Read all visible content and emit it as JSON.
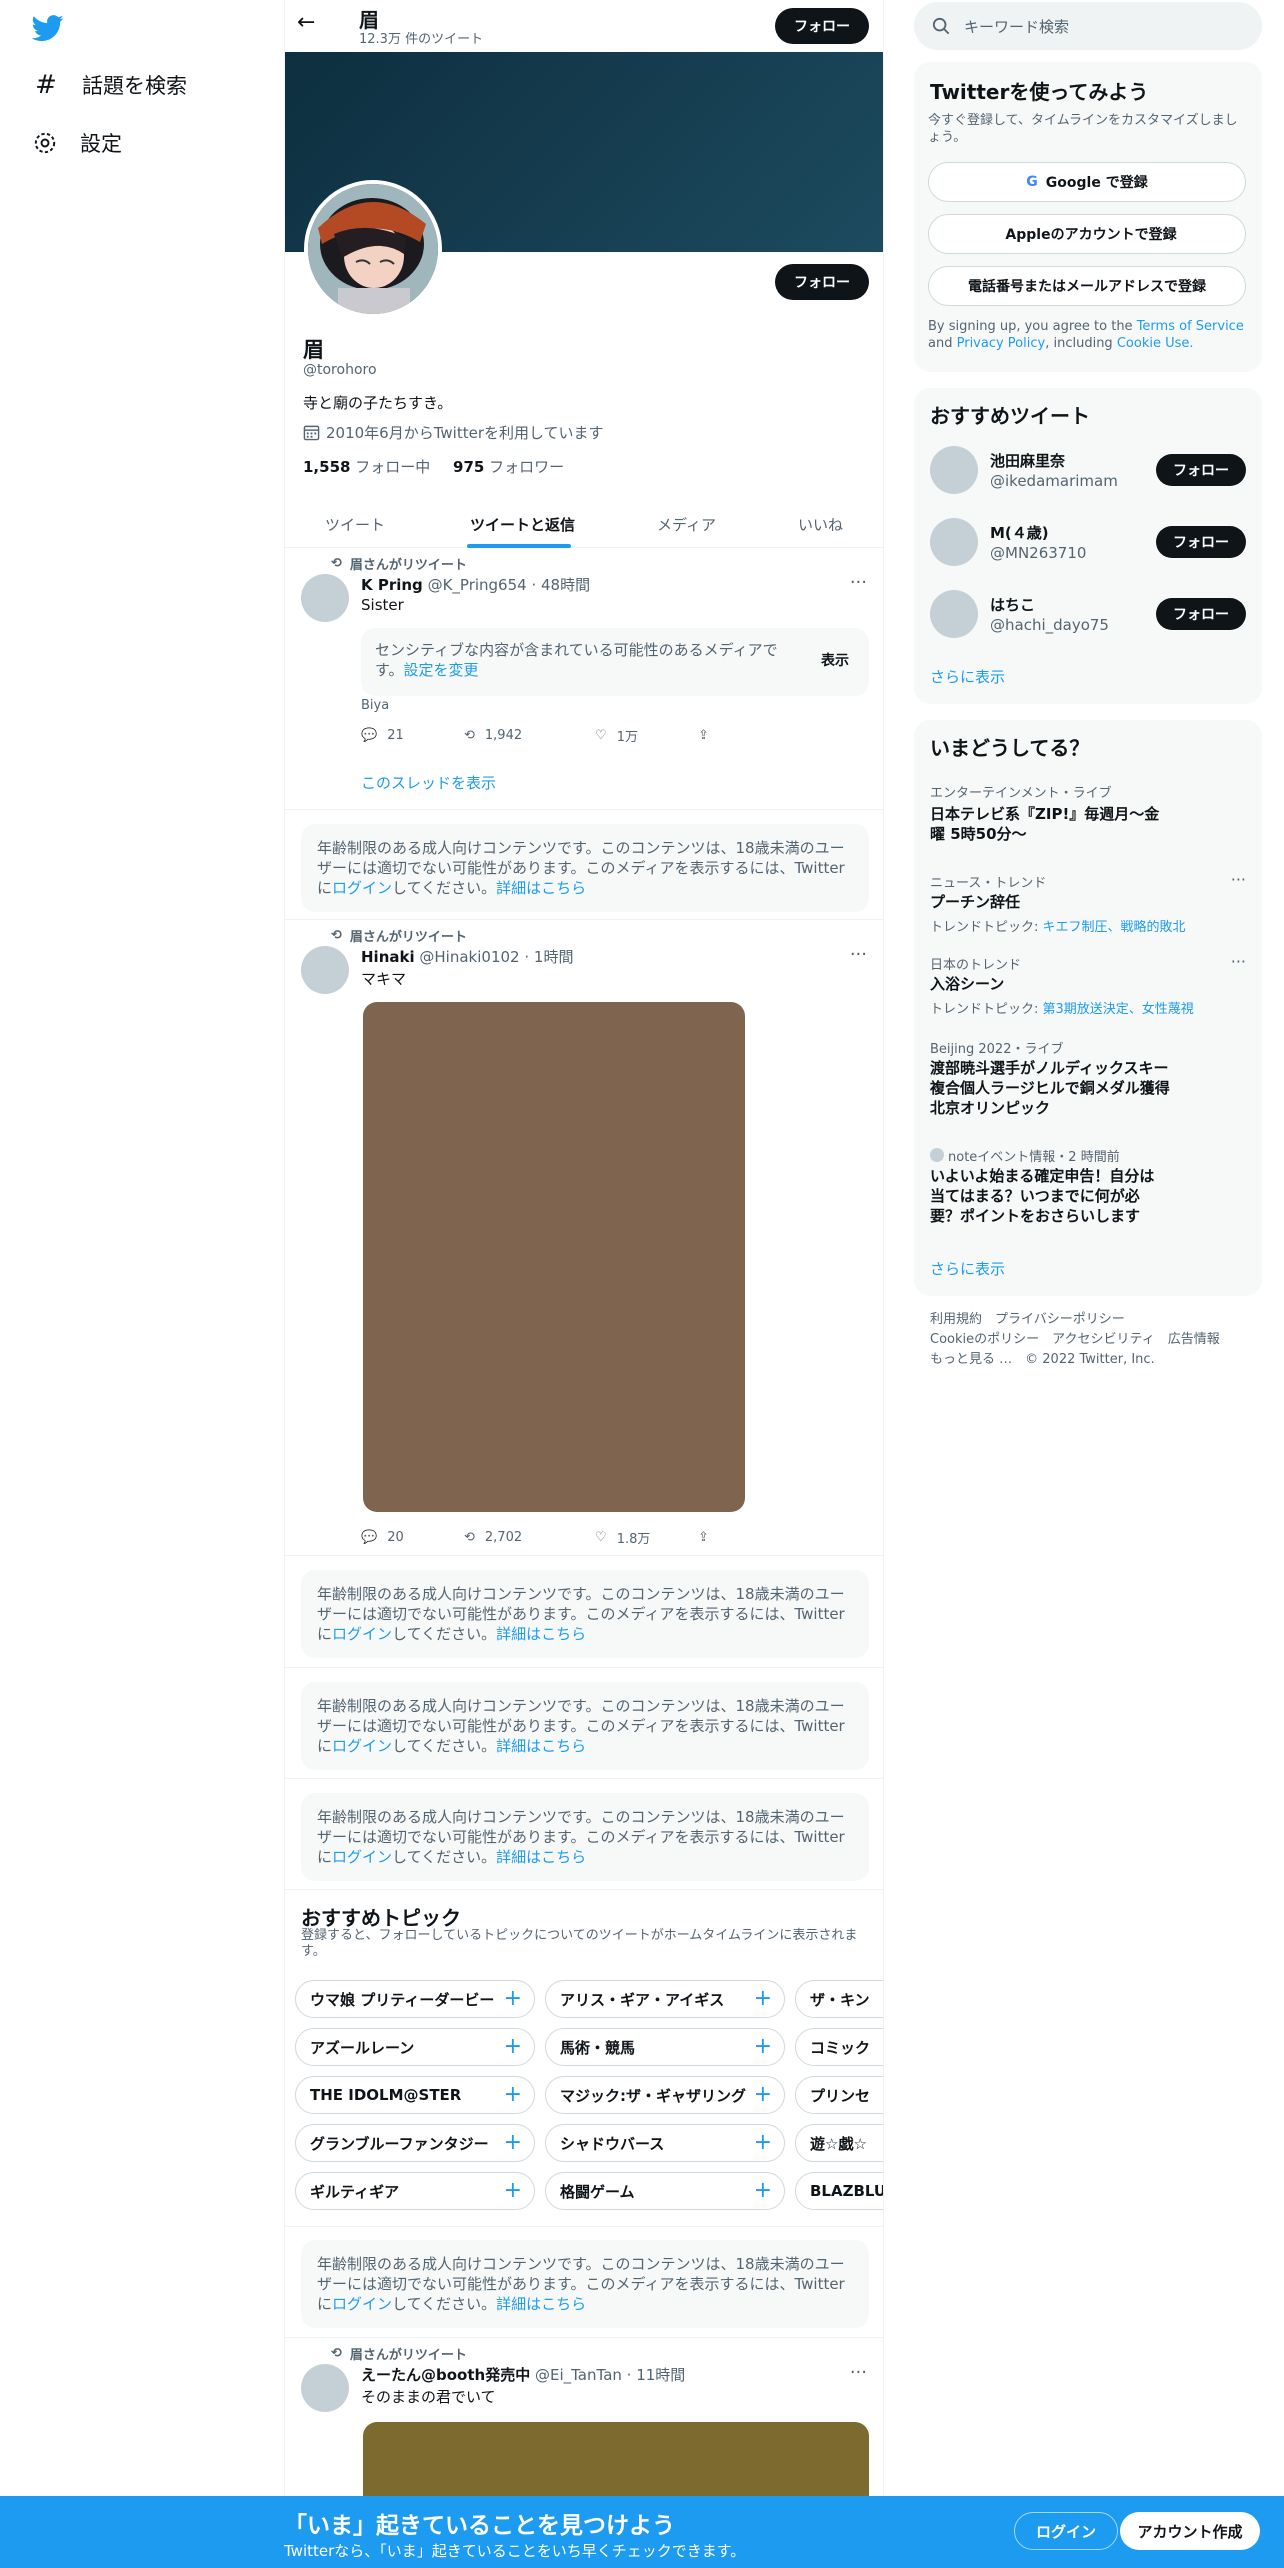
{
  "nav": {
    "items": [
      {
        "label": "話題を検索",
        "icon": "hashtag-icon"
      },
      {
        "label": "設定",
        "icon": "gear-icon"
      }
    ]
  },
  "header": {
    "name": "眉",
    "tweet_count": "12.3万 件のツイート",
    "follow_label": "フォロー"
  },
  "profile": {
    "name": "眉",
    "handle": "@torohoro",
    "bio": "寺と廟の子たちすき。",
    "joined": "2010年6月からTwitterを利用しています",
    "following_count": "1,558",
    "following_label": "フォロー中",
    "followers_count": "975",
    "followers_label": "フォロワー",
    "follow_label": "フォロー"
  },
  "tabs": [
    "ツイート",
    "ツイートと返信",
    "メディア",
    "いいね"
  ],
  "tweets": [
    {
      "retweet_label": "眉さんがリツイート",
      "name": "K Pring",
      "handle": "@K_Pring654",
      "time": "48時間",
      "text": "Sister",
      "sensitive": "センシティブな内容が含まれている可能性のあるメディアです。",
      "sensitive_link": "設定を変更",
      "sensitive_show": "表示",
      "caption": "Biya",
      "replies": "21",
      "retweets": "1,942",
      "likes": "1万",
      "thread_link": "このスレッドを表示"
    },
    {
      "retweet_label": "眉さんがリツイート",
      "name": "Hinaki",
      "handle": "@Hinaki0102",
      "time": "1時間",
      "text": "マキマ",
      "replies": "20",
      "retweets": "2,702",
      "likes": "1.8万"
    },
    {
      "retweet_label": "眉さんがリツイート",
      "name": "えーたん@booth発売中",
      "handle": "@Ei_TanTan",
      "time": "11時間",
      "text": "そのままの君でいて"
    }
  ],
  "notice": {
    "text": "年齢制限のある成人向けコンテンツです。このコンテンツは、18歳未満のユーザーには適切でない可能性があります。このメディアを表示するには、Twitterに",
    "login": "ログイン",
    "after": "してください。",
    "more": "詳細はこちら"
  },
  "topics": {
    "title": "おすすめトピック",
    "subtitle": "登録すると、フォローしているトピックについてのツイートがホームタイムラインに表示されます。",
    "rows": [
      [
        "ウマ娘 プリティーダービー",
        "アリス・ギア・アイギス",
        "ザ・キン"
      ],
      [
        "アズールレーン",
        "馬術・競馬",
        "コミック"
      ],
      [
        "THE IDOLM@STER",
        "マジック:ザ・ギャザリング",
        "プリンセ"
      ],
      [
        "グランブルーファンタジー",
        "シャドウバース",
        "遊☆戯☆"
      ],
      [
        "ギルティギア",
        "格闘ゲーム",
        "BLAZBLU"
      ]
    ]
  },
  "search": {
    "placeholder": "キーワード検索"
  },
  "signup": {
    "title": "Twitterを使ってみよう",
    "subtitle": "今すぐ登録して、タイムラインをカスタマイズしましょう。",
    "google": "Google で登録",
    "apple": "Appleのアカウントで登録",
    "phone": "電話番号またはメールアドレスで登録",
    "terms_pre": "By signing up, you agree to the",
    "terms": "Terms of Service",
    "and": "and",
    "privacy": "Privacy Policy",
    "including": ", including",
    "cookie": "Cookie Use."
  },
  "recommend": {
    "title": "おすすめツイート",
    "users": [
      {
        "name": "池田麻里奈",
        "handle": "@ikedamarimam"
      },
      {
        "name": "M(４歳)",
        "handle": "@MN263710"
      },
      {
        "name": "はちこ",
        "handle": "@hachi_dayo75"
      }
    ],
    "follow_label": "フォロー",
    "more": "さらに表示"
  },
  "trends": {
    "title": "いまどうしてる？",
    "items": [
      {
        "category": "エンターテインメント・ライブ",
        "title": "日本テレビ系『ZIP!』毎週月〜金曜 5時50分〜"
      },
      {
        "category": "ニュース・トレンド",
        "title": "プーチン辞任",
        "sub_pre": "トレンドトピック: ",
        "sub": "キエフ制圧、戦略的敗北"
      },
      {
        "category": "日本のトレンド",
        "title": "入浴シーン",
        "sub_pre": "トレンドトピック: ",
        "sub": "第3期放送決定、女性蔑視"
      },
      {
        "category": "Beijing 2022・ライブ",
        "title": "渡部暁斗選手がノルディックスキー複合個人ラージヒルで銅メダル獲得　北京オリンピック"
      },
      {
        "category": "noteイベント情報・2 時間前",
        "title": "いよいよ始まる確定申告！自分は当てはまる？いつまでに何が必要？ポイントをおさらいします"
      }
    ],
    "more": "さらに表示"
  },
  "footer": [
    "利用規約",
    "プライバシーポリシー",
    "Cookieのポリシー",
    "アクセシビリティ",
    "広告情報",
    "もっと見る …",
    "© 2022 Twitter, Inc."
  ],
  "bottom": {
    "title": "「いま」起きていることを見つけよう",
    "subtitle": "Twitterなら、「いま」起きていることをいち早くチェックできます。",
    "login": "ログイン",
    "signup": "アカウント作成"
  },
  "colors": {
    "accent": "#1d9bf0",
    "banner": "#123848",
    "media1": "#7f6450",
    "media2": "#7d6a2e"
  }
}
